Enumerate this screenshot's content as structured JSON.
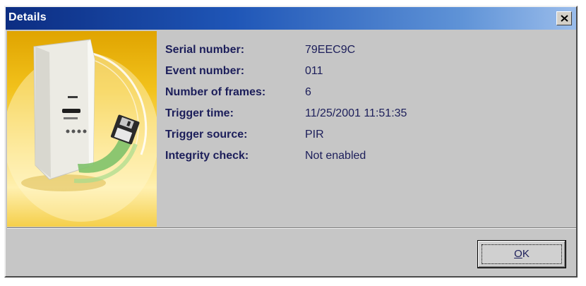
{
  "window": {
    "title": "Details"
  },
  "illustration": {
    "icon": "motion-detector-camera-with-floppy-disk"
  },
  "details": [
    {
      "label": "Serial number:",
      "value": "79EEC9C"
    },
    {
      "label": "Event number:",
      "value": "011"
    },
    {
      "label": "Number of frames:",
      "value": "6"
    },
    {
      "label": "Trigger time:",
      "value": "11/25/2001 11:51:35"
    },
    {
      "label": "Trigger source:",
      "value": "PIR"
    },
    {
      "label": "Integrity check:",
      "value": "Not enabled"
    }
  ],
  "buttons": {
    "ok_accel": "O",
    "ok_rest": "K"
  },
  "colors": {
    "titlebar_start": "#0c2d82",
    "titlebar_end": "#9bbdeb",
    "dialog_bg": "#c6c6c6",
    "text": "#1c1e5a"
  }
}
